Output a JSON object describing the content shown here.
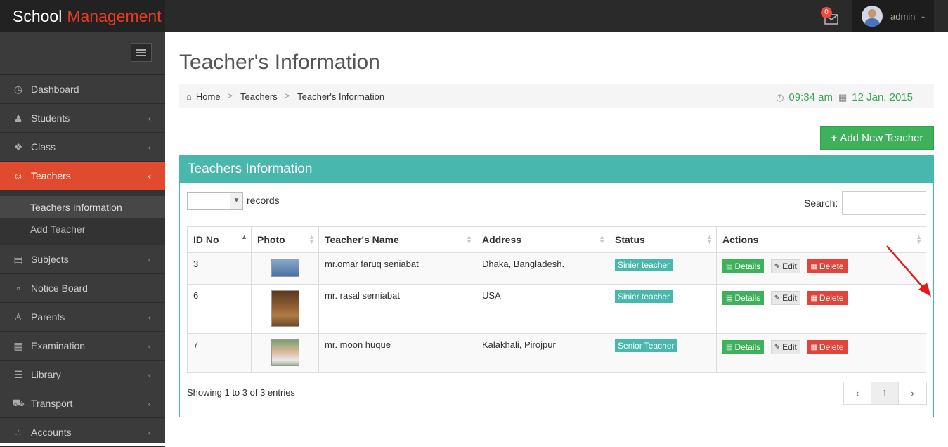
{
  "brand": {
    "part1": "School",
    "part2": "Management"
  },
  "header": {
    "mail_count": "0",
    "user": "admin"
  },
  "sidebar": {
    "items": [
      {
        "label": "Dashboard",
        "icon": "dashboard-icon"
      },
      {
        "label": "Students",
        "icon": "users-icon"
      },
      {
        "label": "Class",
        "icon": "cubes-icon"
      },
      {
        "label": "Teachers",
        "icon": "teacher-icon"
      },
      {
        "label": "Subjects",
        "icon": "book-icon"
      },
      {
        "label": "Notice Board",
        "icon": "clipboard-icon"
      },
      {
        "label": "Parents",
        "icon": "user-icon"
      },
      {
        "label": "Examination",
        "icon": "table-icon"
      },
      {
        "label": "Library",
        "icon": "list-icon"
      },
      {
        "label": "Transport",
        "icon": "truck-icon"
      },
      {
        "label": "Accounts",
        "icon": "share-icon"
      }
    ],
    "sub": {
      "teachers_info": "Teachers Information",
      "add_teacher": "Add Teacher"
    }
  },
  "page": {
    "title": "Teacher's Information"
  },
  "breadcrumb": {
    "home": "Home",
    "teachers": "Teachers",
    "current": "Teacher's Information"
  },
  "datetime": {
    "time": "09:34 am",
    "date": "12 Jan, 2015"
  },
  "add_button": "Add New Teacher",
  "panel": {
    "title": "Teachers Information",
    "records_label": "records",
    "search_label": "Search:",
    "columns": [
      "ID No",
      "Photo",
      "Teacher's Name",
      "Address",
      "Status",
      "Actions"
    ],
    "rows": [
      {
        "id": "3",
        "name": "mr.omar faruq seniabat",
        "address": "Dhaka, Bangladesh.",
        "status": "Sinier teacher"
      },
      {
        "id": "6",
        "name": "mr. rasal serniabat",
        "address": "USA",
        "status": "Sinier teacher"
      },
      {
        "id": "7",
        "name": "mr. moon huque",
        "address": "Kalakhali, Pirojpur",
        "status": "Senior Teacher"
      }
    ],
    "actions": {
      "details": "Details",
      "edit": "Edit",
      "delete": "Delete"
    },
    "footer": "Showing 1 to 3 of 3 entries",
    "pagination": {
      "prev": "‹",
      "page": "1",
      "next": "›"
    }
  },
  "colors": {
    "accent": "#48b8ac",
    "active_nav": "#e04b2f",
    "success": "#3eb15a",
    "danger": "#e0443a"
  }
}
